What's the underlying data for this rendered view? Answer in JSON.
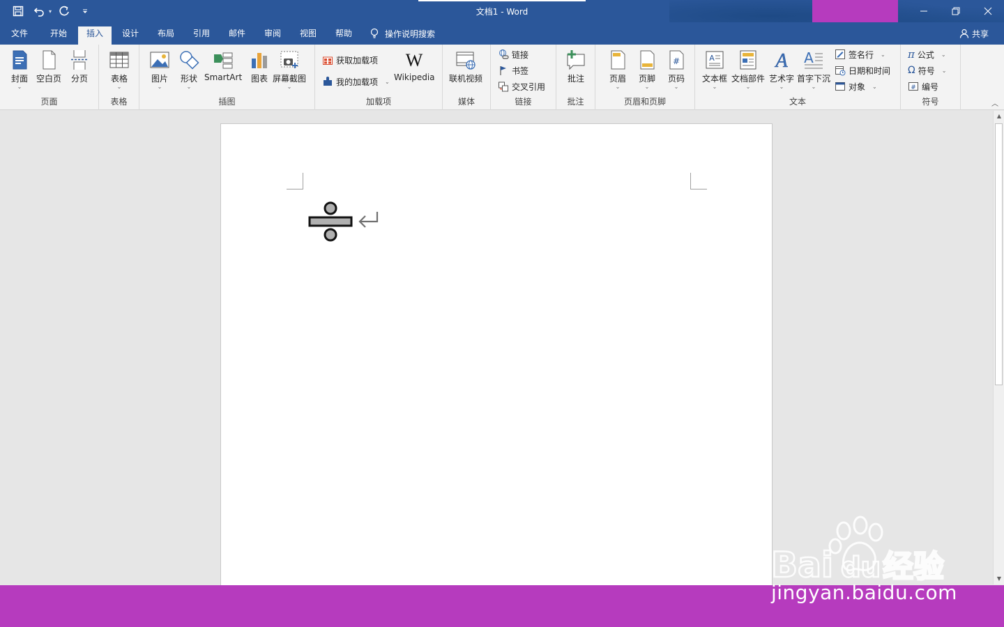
{
  "window": {
    "title": "文档1  -  Word",
    "controls": [
      "minimize-icon",
      "restore-icon",
      "close-icon"
    ]
  },
  "quick_access": [
    "save-icon",
    "undo-icon",
    "redo-icon",
    "customize-icon"
  ],
  "tabs": [
    {
      "label": "文件",
      "active": false
    },
    {
      "label": "开始",
      "active": false
    },
    {
      "label": "插入",
      "active": true
    },
    {
      "label": "设计",
      "active": false
    },
    {
      "label": "布局",
      "active": false
    },
    {
      "label": "引用",
      "active": false
    },
    {
      "label": "邮件",
      "active": false
    },
    {
      "label": "审阅",
      "active": false
    },
    {
      "label": "视图",
      "active": false
    },
    {
      "label": "帮助",
      "active": false
    }
  ],
  "tell_me": "操作说明搜索",
  "share": "共享",
  "ribbon": {
    "groups": {
      "pages": {
        "label": "页面",
        "items": [
          "封面",
          "空白页",
          "分页"
        ]
      },
      "tables": {
        "label": "表格",
        "items": [
          "表格"
        ]
      },
      "illustrations": {
        "label": "插图",
        "items": [
          "图片",
          "形状",
          "SmartArt",
          "图表",
          "屏幕截图"
        ]
      },
      "addins": {
        "label": "加载项",
        "items": [
          "获取加载项",
          "我的加载项",
          "Wikipedia"
        ]
      },
      "media": {
        "label": "媒体",
        "items": [
          "联机视频"
        ]
      },
      "links": {
        "label": "链接",
        "items": [
          "链接",
          "书签",
          "交叉引用"
        ]
      },
      "comments": {
        "label": "批注",
        "items": [
          "批注"
        ]
      },
      "header_footer": {
        "label": "页眉和页脚",
        "items": [
          "页眉",
          "页脚",
          "页码"
        ]
      },
      "text": {
        "label": "文本",
        "items": [
          "文本框",
          "文档部件",
          "艺术字",
          "首字下沉",
          "签名行",
          "日期和时间",
          "对象"
        ]
      },
      "symbols": {
        "label": "符号",
        "items": [
          "公式",
          "符号",
          "编号"
        ]
      }
    }
  },
  "document": {
    "content_symbol": "division-sign",
    "paragraph_mark": "enter-icon"
  },
  "watermark": {
    "text": "jingyan.baidu.com",
    "logo": "baidu-jingyan-logo"
  },
  "colors": {
    "accent": "#2b579a",
    "ribbon_bg": "#f3f3f3",
    "magenta": "#b63bbe"
  }
}
